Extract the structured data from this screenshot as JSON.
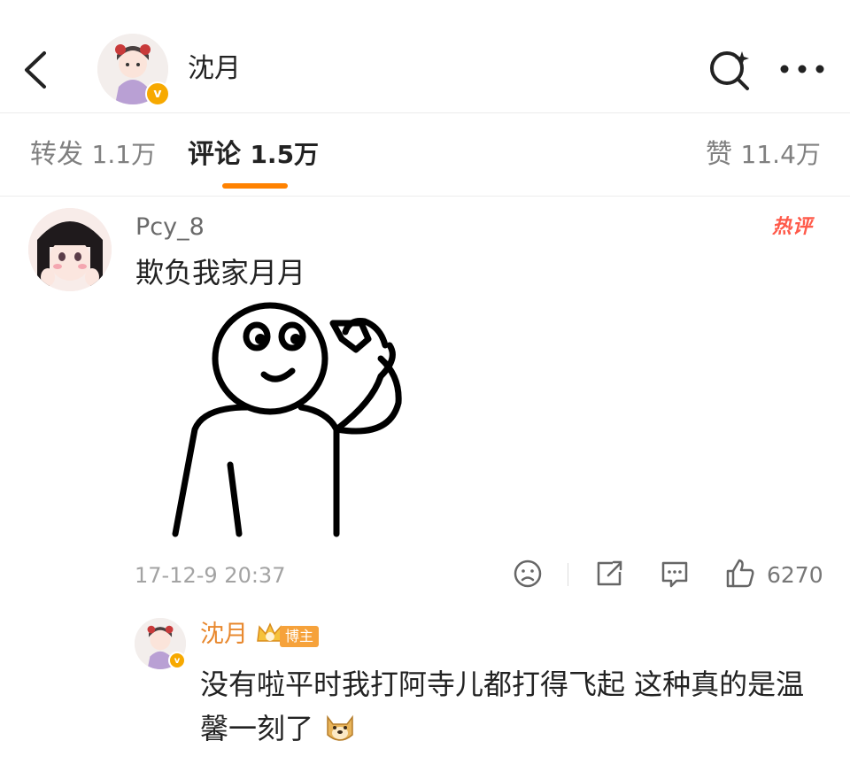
{
  "header": {
    "name": "沈月",
    "back_icon": "chevron-left-icon",
    "search_icon": "search-icon",
    "more_icon": "more-dots-icon"
  },
  "tabs": [
    {
      "label": "转发",
      "count": "1.1万",
      "active": false
    },
    {
      "label": "评论",
      "count": "1.5万",
      "active": true
    },
    {
      "label": "赞",
      "count": "11.4万",
      "active": false
    }
  ],
  "comment": {
    "username": "Pcy_8",
    "hot_badge": "热评",
    "text": "欺负我家月月",
    "timestamp": "17-12-9 20:37",
    "likes": "6270"
  },
  "reply": {
    "username": "沈月",
    "badge": "博主",
    "text": "没有啦平时我打阿寺儿都打得飞起 这种真的是温馨一刻了"
  },
  "colors": {
    "accent": "#ff8200",
    "hot": "#ff5a4a",
    "blogger_name": "#e8882e",
    "verified": "#f7a900"
  }
}
